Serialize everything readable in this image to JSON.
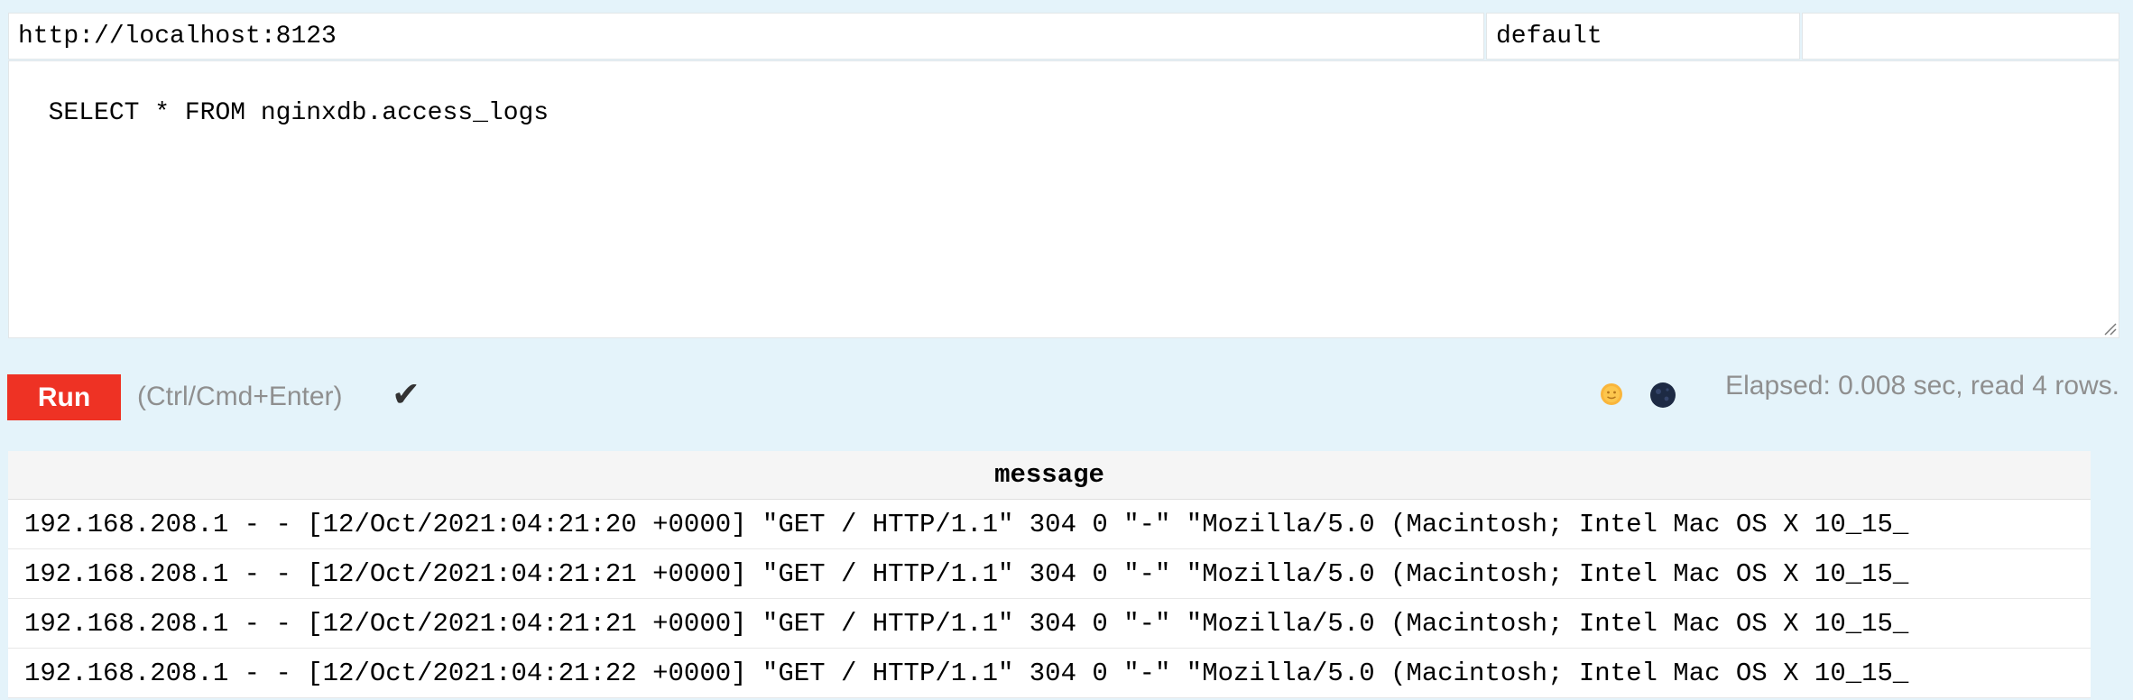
{
  "connection": {
    "url": "http://localhost:8123",
    "user": "default",
    "password": ""
  },
  "query": {
    "text": "SELECT * FROM nginxdb.access_logs"
  },
  "toolbar": {
    "run_label": "Run",
    "shortcut_hint": "(Ctrl/Cmd+Enter)",
    "status_mark": "✔",
    "stats": "Elapsed: 0.008 sec, read 4 rows."
  },
  "theme_icons": [
    "sun-icon",
    "moon-icon"
  ],
  "colors": {
    "run_button": "#ee3224",
    "background": "#e4f3fa"
  },
  "results": {
    "columns": [
      "message"
    ],
    "rows": [
      "192.168.208.1 - - [12/Oct/2021:04:21:20 +0000] \"GET / HTTP/1.1\" 304 0 \"-\" \"Mozilla/5.0 (Macintosh; Intel Mac OS X 10_15_",
      "192.168.208.1 - - [12/Oct/2021:04:21:21 +0000] \"GET / HTTP/1.1\" 304 0 \"-\" \"Mozilla/5.0 (Macintosh; Intel Mac OS X 10_15_",
      "192.168.208.1 - - [12/Oct/2021:04:21:21 +0000] \"GET / HTTP/1.1\" 304 0 \"-\" \"Mozilla/5.0 (Macintosh; Intel Mac OS X 10_15_",
      "192.168.208.1 - - [12/Oct/2021:04:21:22 +0000] \"GET / HTTP/1.1\" 304 0 \"-\" \"Mozilla/5.0 (Macintosh; Intel Mac OS X 10_15_"
    ]
  }
}
